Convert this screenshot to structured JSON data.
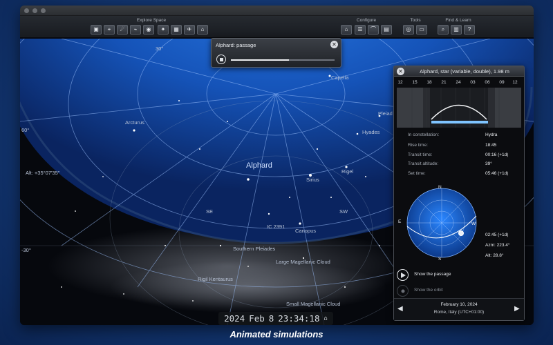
{
  "toolbar": {
    "groups": [
      {
        "label": "Explore Space"
      },
      {
        "label": "Configure"
      },
      {
        "label": "Tools"
      },
      {
        "label": "Find & Learn"
      }
    ],
    "buttons": [
      {
        "icon": "map-icon",
        "glyph": "▣"
      },
      {
        "icon": "pin-icon",
        "glyph": "⌖"
      },
      {
        "icon": "comet-icon",
        "glyph": "☄"
      },
      {
        "icon": "telescope-icon",
        "glyph": "⌁"
      },
      {
        "icon": "orbit-icon",
        "glyph": "◉"
      },
      {
        "icon": "constellation-icon",
        "glyph": "✦"
      },
      {
        "icon": "calendar-icon",
        "glyph": "▦"
      },
      {
        "icon": "satellite-icon",
        "glyph": "✈"
      },
      {
        "icon": "observatory-icon",
        "glyph": "⌂"
      },
      {
        "icon": "home-icon",
        "glyph": "⌂"
      },
      {
        "icon": "sliders-icon",
        "glyph": "☰"
      },
      {
        "icon": "horizon-icon",
        "glyph": "⌒"
      },
      {
        "icon": "grid-icon",
        "glyph": "▤"
      },
      {
        "icon": "compass-icon",
        "glyph": "◎"
      },
      {
        "icon": "display-icon",
        "glyph": "▭"
      },
      {
        "icon": "search-icon",
        "glyph": "⌕"
      },
      {
        "icon": "book-icon",
        "glyph": "▥"
      },
      {
        "icon": "help-icon",
        "glyph": "?"
      }
    ]
  },
  "sky": {
    "altitude_readout": "Alt: +35°07'35\"",
    "selected_label": "Alphard",
    "labels": {
      "arcturus": "Arcturus",
      "capella": "Capella",
      "pleiades": "Pleiad",
      "hyades": "Hyades",
      "rigel": "Rigel",
      "sirius": "Sirius",
      "canopus": "Canopus",
      "ic2391": "IC 2391",
      "southern_pleiades": "Southern Pleiades",
      "lmc": "Large Magellanic Cloud",
      "smc": "Small Magellanic Cloud",
      "rigil": "Rigil Kentaurus",
      "se": "SE",
      "sw": "SW",
      "ticks": [
        "30°",
        "60°",
        "-30°"
      ]
    }
  },
  "datetime": {
    "year": "2024",
    "month": "Feb",
    "day": "8",
    "time": "23:34:18",
    "home_glyph": "⌂"
  },
  "animation": {
    "title": "Alphard: passage",
    "close_glyph": "✕",
    "progress": 0.56
  },
  "info": {
    "title": "Alphard, star (variable, double), 1.98 m",
    "close_glyph": "✕",
    "hours": [
      "12",
      "15",
      "18",
      "21",
      "24",
      "03",
      "06",
      "09",
      "12"
    ],
    "fields": [
      {
        "key": "In constellation:",
        "value": "Hydra"
      },
      {
        "key": "Rise time:",
        "value": "18:45"
      },
      {
        "key": "Transit time:",
        "value": "00:16 (+1d)"
      },
      {
        "key": "Transit altitude:",
        "value": "39°"
      },
      {
        "key": "Set time:",
        "value": "05:46 (+1d)"
      }
    ],
    "compass": {
      "n": "N",
      "s": "S",
      "e": "E",
      "w": "W"
    },
    "side": {
      "time": "02:45 (+1d)",
      "azm": "Azm: 223.4°",
      "alt": "Alt: 28.8°"
    },
    "show_passage": "Show the passage",
    "show_orbit": "Show the orbit",
    "date": "February 10, 2024",
    "location": "Rome, Italy (UTC+01:00)",
    "prev_glyph": "◀",
    "next_glyph": "▶"
  },
  "caption": "Animated simulations"
}
